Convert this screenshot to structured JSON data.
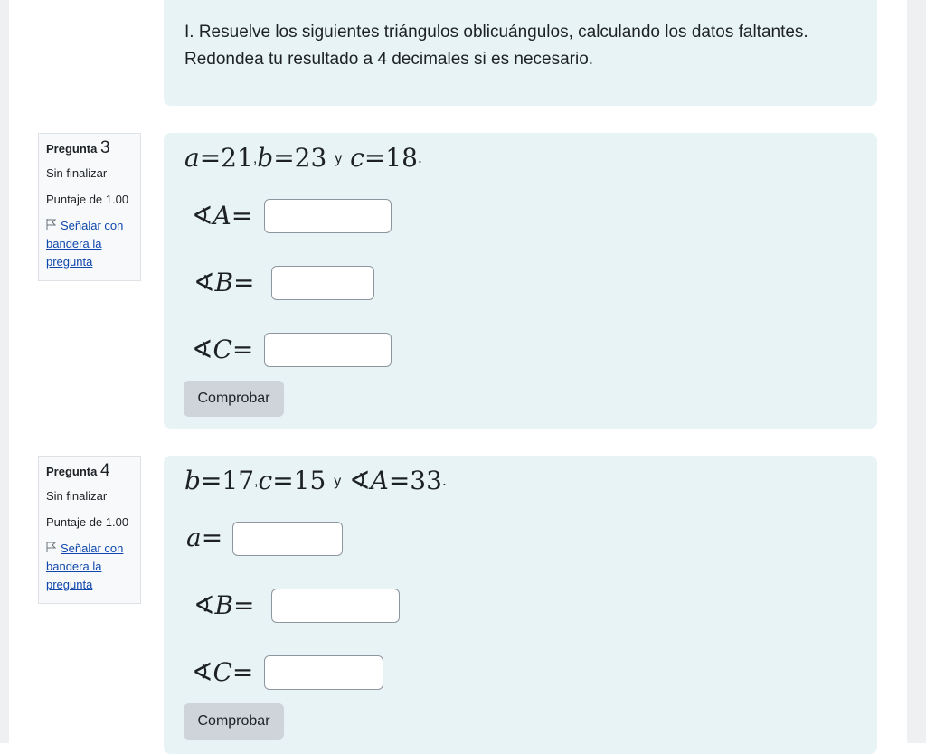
{
  "intro": {
    "line1": "I. Resuelve los siguientes triángulos oblicuángulos, calculando los datos faltantes.",
    "line2": "Redondea tu resultado a 4 decimales si es necesario."
  },
  "q3": {
    "label": "Pregunta",
    "number": "3",
    "state": "Sin finalizar",
    "grade": "Puntaje de 1.00",
    "flag": "Señalar con bandera la pregunta",
    "given": {
      "a_var": "a",
      "a_val": "21",
      "b_var": "b",
      "b_val": "23",
      "c_var": "c",
      "c_val": "18",
      "sep": ",",
      "y": "y",
      "end": "."
    },
    "fields": [
      {
        "angle": "∢",
        "var": "A",
        "eq": "=",
        "value": ""
      },
      {
        "angle": "∢",
        "var": "B",
        "eq": "=",
        "value": ""
      },
      {
        "angle": "∢",
        "var": "C",
        "eq": "=",
        "value": ""
      }
    ],
    "check": "Comprobar"
  },
  "q4": {
    "label": "Pregunta",
    "number": "4",
    "state": "Sin finalizar",
    "grade": "Puntaje de 1.00",
    "flag": "Señalar con bandera la pregunta",
    "given": {
      "b_var": "b",
      "b_val": "17",
      "c_var": "c",
      "c_val": "15",
      "angle": "∢",
      "A_var": "A",
      "A_val": "33",
      "sep": ",",
      "y": "y",
      "end": "."
    },
    "fields": [
      {
        "angle": "",
        "var": "a",
        "eq": "=",
        "value": ""
      },
      {
        "angle": "∢",
        "var": "B",
        "eq": "=",
        "value": ""
      },
      {
        "angle": "∢",
        "var": "C",
        "eq": "=",
        "value": ""
      }
    ],
    "check": "Comprobar"
  },
  "icons": {
    "flag": "flag-icon"
  },
  "colors": {
    "panel": "#e7f3f5",
    "link": "#0f47ad",
    "button": "#ced4da"
  }
}
